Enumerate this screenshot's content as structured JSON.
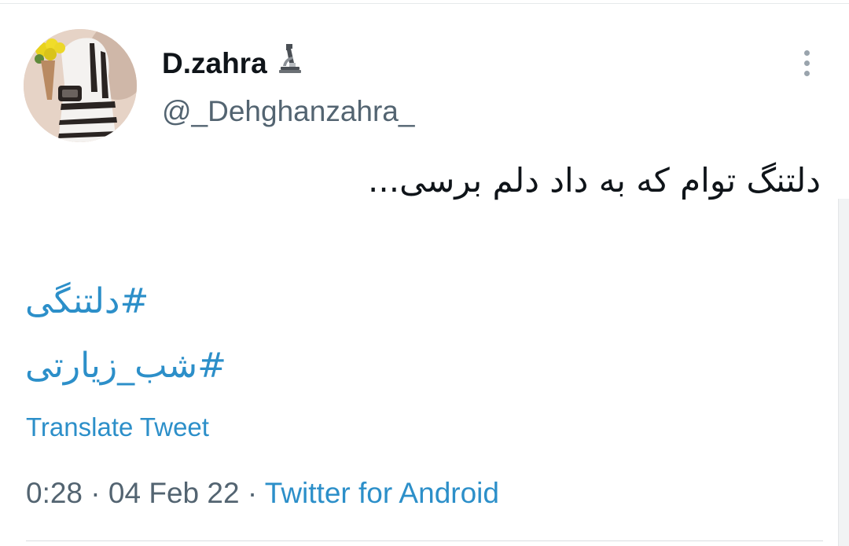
{
  "tweet": {
    "author": {
      "display_name": "D.zahra",
      "name_emoji_icon": "microscope-icon",
      "handle": "@_Dehghanzahra_"
    },
    "text": "دلتنگ توام که به داد دلم برسی...",
    "hashtags": [
      "#دلتنگی",
      "#شب_زیارتی"
    ],
    "translate_label": "Translate Tweet",
    "time": "0:28",
    "separator": "·",
    "date": "04 Feb 22",
    "source": "Twitter for Android"
  },
  "colors": {
    "link": "#2c8fc9",
    "secondary_text": "#536471",
    "primary_text": "#0f1419"
  }
}
